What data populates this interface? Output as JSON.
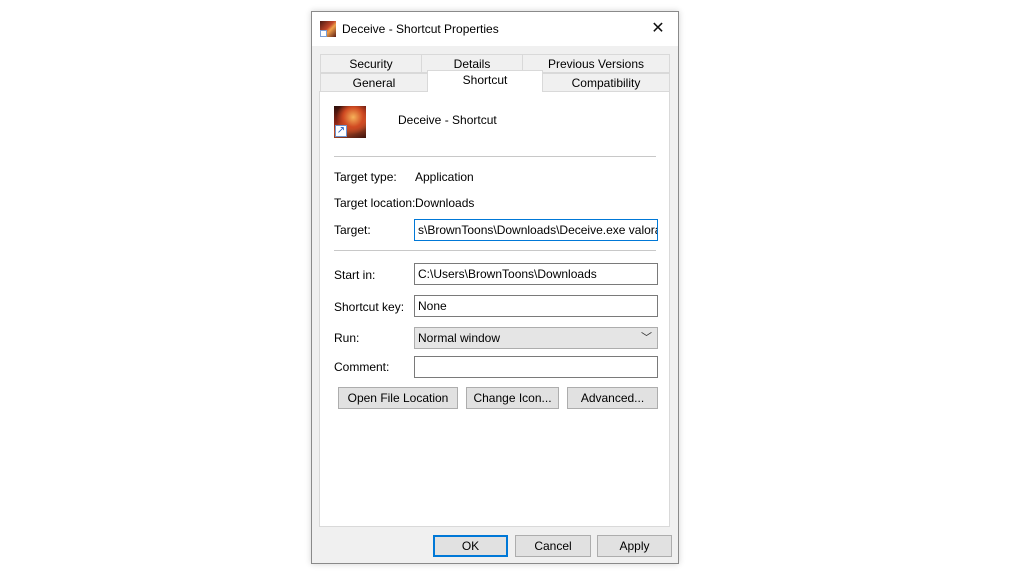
{
  "window": {
    "title": "Deceive - Shortcut Properties",
    "close_glyph": "✕",
    "icon": "app-icon"
  },
  "tabs": {
    "row1": [
      "Security",
      "Details",
      "Previous Versions"
    ],
    "row2": [
      "General",
      "Shortcut",
      "Compatibility"
    ],
    "active": "Shortcut"
  },
  "shortcut": {
    "name": "Deceive - Shortcut",
    "target_type_label": "Target type:",
    "target_type_value": "Application",
    "target_location_label": "Target location:",
    "target_location_value": "Downloads",
    "target_label": "Target:",
    "target_value": "s\\BrownToons\\Downloads\\Deceive.exe valorant",
    "start_in_label": "Start in:",
    "start_in_value": "C:\\Users\\BrownToons\\Downloads",
    "shortcut_key_label": "Shortcut key:",
    "shortcut_key_value": "None",
    "run_label": "Run:",
    "run_value": "Normal window",
    "comment_label": "Comment:",
    "comment_value": ""
  },
  "actions": {
    "open_file_location": "Open File Location",
    "change_icon": "Change Icon...",
    "advanced": "Advanced..."
  },
  "footer": {
    "ok": "OK",
    "cancel": "Cancel",
    "apply": "Apply"
  }
}
